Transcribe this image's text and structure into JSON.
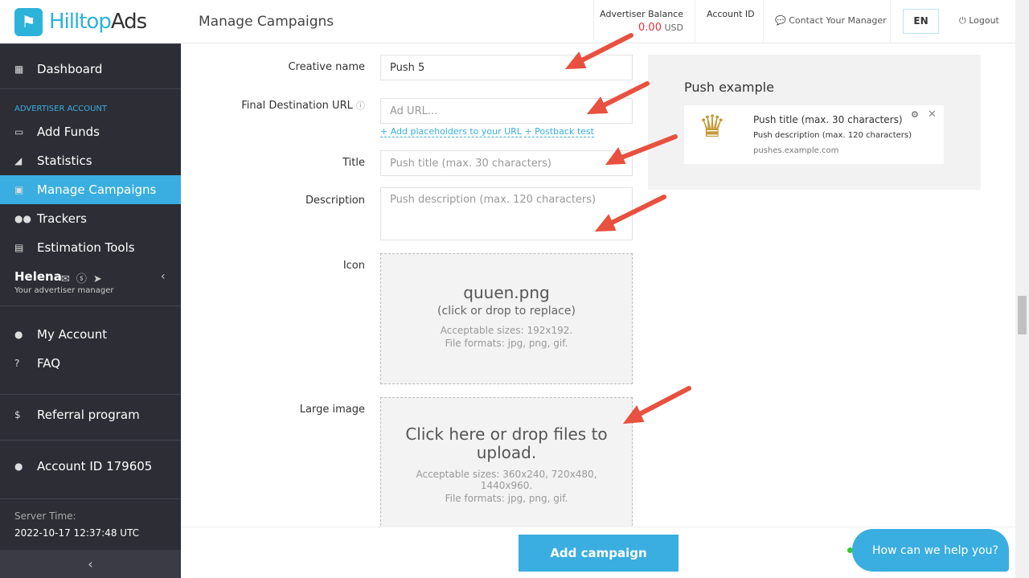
{
  "brand": {
    "name_a": "Hilltop",
    "name_b": "Ads"
  },
  "header": {
    "title": "Manage Campaigns",
    "balance_label": "Advertiser Balance",
    "balance_value": "0.00",
    "balance_currency": "USD",
    "account_id_label": "Account ID",
    "contact": "Contact Your Manager",
    "lang": "EN",
    "logout": "Logout"
  },
  "sidebar": {
    "dashboard": "Dashboard",
    "section": "ADVERTISER ACCOUNT",
    "items": [
      {
        "label": "Add Funds",
        "icon": "credit-card"
      },
      {
        "label": "Statistics",
        "icon": "chart"
      },
      {
        "label": "Manage Campaigns",
        "icon": "briefcase"
      },
      {
        "label": "Trackers",
        "icon": "users"
      },
      {
        "label": "Estimation Tools",
        "icon": "calculator"
      }
    ],
    "manager_name": "Helena",
    "manager_role": "Your advertiser manager",
    "my_account": "My Account",
    "faq": "FAQ",
    "referral": "Referral program",
    "account_id": "Account ID 179605",
    "server_time_label": "Server Time:",
    "server_time": "2022-10-17 12:37:48 UTC"
  },
  "form": {
    "creative_name_label": "Creative name",
    "creative_name_value": "Push 5",
    "url_label": "Final Destination URL",
    "url_placeholder": "Ad URL...",
    "add_placeholders": "+ Add placeholders to your URL",
    "postback": "+ Postback test",
    "title_label": "Title",
    "title_placeholder": "Push title (max. 30 characters)",
    "desc_label": "Description",
    "desc_placeholder": "Push description (max. 120 characters)",
    "icon_label": "Icon",
    "icon_file": "quuen.png",
    "icon_replace": "(click or drop to replace)",
    "icon_sizes": "Acceptable sizes: 192x192.",
    "icon_formats": "File formats: jpg, png, gif.",
    "large_label": "Large image",
    "large_cta": "Click here or drop files to upload.",
    "large_sizes": "Acceptable sizes: 360x240, 720x480, 1440x960.",
    "large_formats": "File formats: jpg, png, gif."
  },
  "preview": {
    "heading": "Push example",
    "title": "Push title (max. 30 characters)",
    "desc": "Push description (max. 120 characters)",
    "domain": "pushes.example.com"
  },
  "add_campaign": "Add campaign",
  "chat": "How can we help you?",
  "colors": {
    "accent": "#3aaee0",
    "sidebar": "#2c2d35",
    "balance": "#e0343f",
    "arrow": "#e8513f"
  }
}
